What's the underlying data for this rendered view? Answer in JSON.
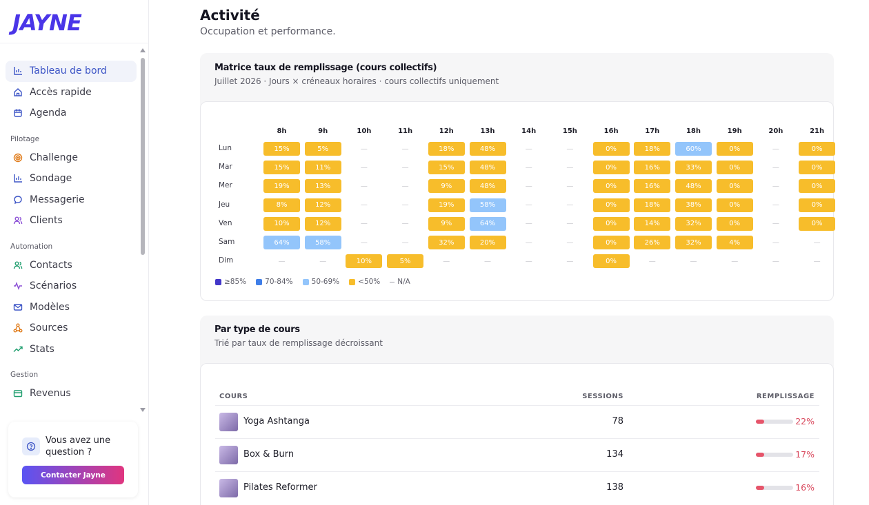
{
  "brand": {
    "logo": "JAYNE",
    "accent": "#4a35e8"
  },
  "sidebar": {
    "main_items": [
      {
        "label": "Tableau de bord",
        "icon": "bar-chart-icon",
        "active": true
      },
      {
        "label": "Accès rapide",
        "icon": "home-icon"
      },
      {
        "label": "Agenda",
        "icon": "calendar-icon"
      }
    ],
    "sections": [
      {
        "title": "Pilotage",
        "items": [
          {
            "label": "Challenge",
            "icon": "target-icon"
          },
          {
            "label": "Sondage",
            "icon": "bar-chart-icon"
          },
          {
            "label": "Messagerie",
            "icon": "message-icon"
          },
          {
            "label": "Clients",
            "icon": "users-icon"
          }
        ]
      },
      {
        "title": "Automation",
        "items": [
          {
            "label": "Contacts",
            "icon": "contacts-icon"
          },
          {
            "label": "Scénarios",
            "icon": "activity-icon"
          },
          {
            "label": "Modèles",
            "icon": "mail-icon"
          },
          {
            "label": "Sources",
            "icon": "sources-icon"
          },
          {
            "label": "Stats",
            "icon": "trending-icon"
          }
        ]
      },
      {
        "title": "Gestion",
        "items": [
          {
            "label": "Revenus",
            "icon": "wallet-icon"
          }
        ]
      }
    ],
    "help": {
      "text": "Vous avez une question ?",
      "button": "Contacter Jayne"
    }
  },
  "page": {
    "title": "Activité",
    "subtitle": "Occupation et performance."
  },
  "heatmap": {
    "title": "Matrice taux de remplissage (cours collectifs)",
    "subtitle": "Juillet 2026 · Jours × créneaux horaires · cours collectifs uniquement",
    "hours": [
      "8h",
      "9h",
      "10h",
      "11h",
      "12h",
      "13h",
      "14h",
      "15h",
      "16h",
      "17h",
      "18h",
      "19h",
      "20h",
      "21h"
    ],
    "days": [
      "Lun",
      "Mar",
      "Mer",
      "Jeu",
      "Ven",
      "Sam",
      "Dim"
    ],
    "rows": [
      [
        "15%",
        "5%",
        "—",
        "—",
        "18%",
        "48%",
        "—",
        "—",
        "0%",
        "18%",
        "60%",
        "0%",
        "—",
        "0%"
      ],
      [
        "15%",
        "11%",
        "—",
        "—",
        "15%",
        "48%",
        "—",
        "—",
        "0%",
        "16%",
        "33%",
        "0%",
        "—",
        "0%"
      ],
      [
        "19%",
        "13%",
        "—",
        "—",
        "9%",
        "48%",
        "—",
        "—",
        "0%",
        "16%",
        "48%",
        "0%",
        "—",
        "0%"
      ],
      [
        "8%",
        "12%",
        "—",
        "—",
        "19%",
        "58%",
        "—",
        "—",
        "0%",
        "18%",
        "38%",
        "0%",
        "—",
        "0%"
      ],
      [
        "10%",
        "12%",
        "—",
        "—",
        "9%",
        "64%",
        "—",
        "—",
        "0%",
        "14%",
        "32%",
        "0%",
        "—",
        "0%"
      ],
      [
        "64%",
        "58%",
        "—",
        "—",
        "32%",
        "20%",
        "—",
        "—",
        "0%",
        "26%",
        "32%",
        "4%",
        "—",
        "—"
      ],
      [
        "—",
        "—",
        "10%",
        "5%",
        "—",
        "—",
        "—",
        "—",
        "0%",
        "—",
        "—",
        "—",
        "—",
        "—"
      ]
    ],
    "legend": [
      {
        "label": "≥85%",
        "color": "#4337c9"
      },
      {
        "label": "70-84%",
        "color": "#3f7ee8"
      },
      {
        "label": "50-69%",
        "color": "#93c5fb"
      },
      {
        "label": "<50%",
        "color": "#f7bd2b"
      },
      {
        "label": "N/A",
        "color": ""
      }
    ],
    "colors": {
      "low": "#f7bd2b",
      "mid": "#93c5fb",
      "high": "#3f7ee8",
      "top": "#4337c9"
    }
  },
  "course_types": {
    "title": "Par type de cours",
    "subtitle": "Trié par taux de remplissage décroissant",
    "columns": {
      "course": "COURS",
      "sessions": "SESSIONS",
      "fill": "REMPLISSAGE"
    },
    "rows": [
      {
        "name": "Yoga Ashtanga",
        "sessions": "78",
        "fill_label": "22%",
        "fill": 0.22
      },
      {
        "name": "Box & Burn",
        "sessions": "134",
        "fill_label": "17%",
        "fill": 0.17
      },
      {
        "name": "Pilates Reformer",
        "sessions": "138",
        "fill_label": "16%",
        "fill": 0.16
      }
    ]
  }
}
